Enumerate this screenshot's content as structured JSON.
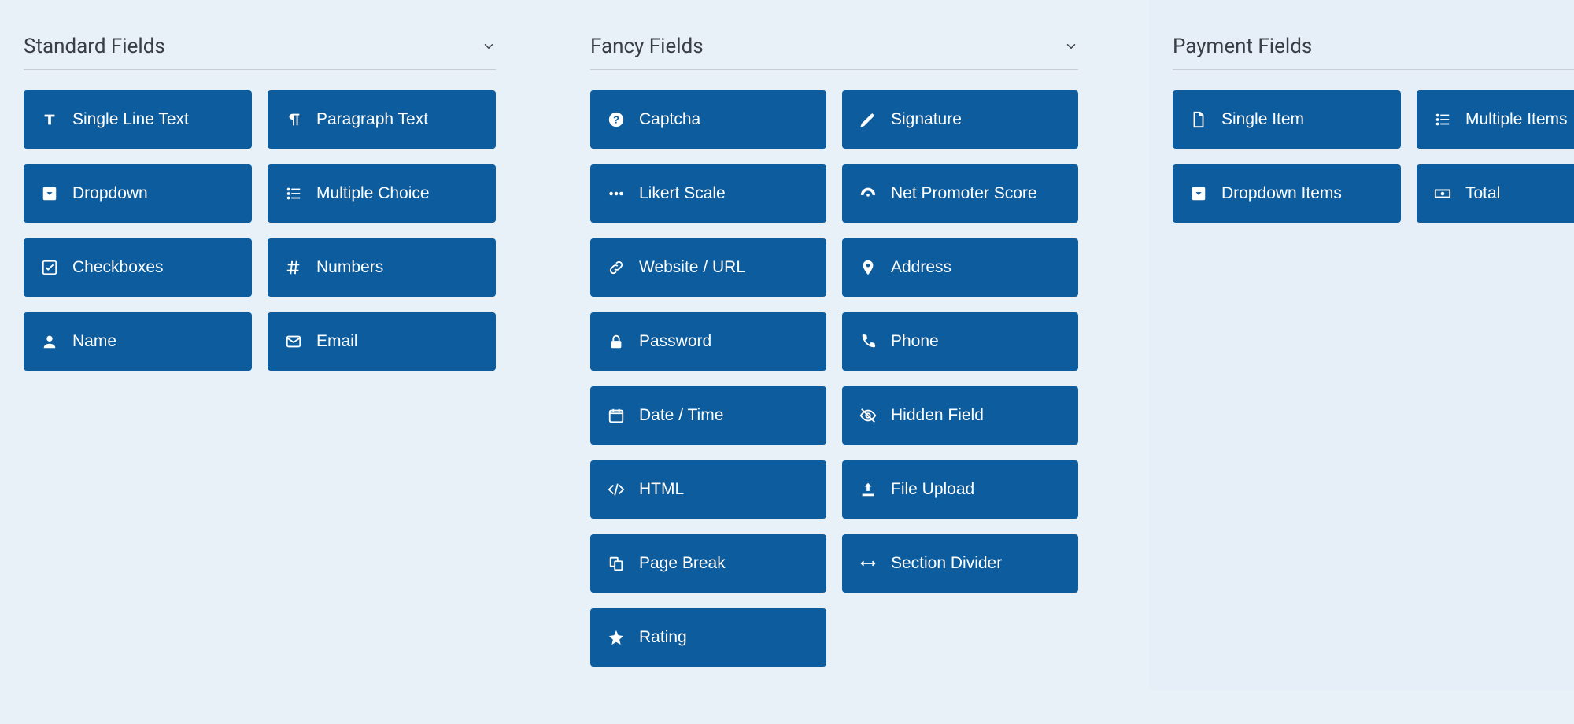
{
  "panels": {
    "standard": {
      "title": "Standard Fields",
      "fields": [
        {
          "label": "Single Line Text",
          "name": "single-line-text",
          "icon": "text-cursor"
        },
        {
          "label": "Paragraph Text",
          "name": "paragraph-text",
          "icon": "paragraph"
        },
        {
          "label": "Dropdown",
          "name": "dropdown",
          "icon": "caret-square"
        },
        {
          "label": "Multiple Choice",
          "name": "multiple-choice",
          "icon": "list"
        },
        {
          "label": "Checkboxes",
          "name": "checkboxes",
          "icon": "check-square"
        },
        {
          "label": "Numbers",
          "name": "numbers",
          "icon": "hashtag"
        },
        {
          "label": "Name",
          "name": "name",
          "icon": "user"
        },
        {
          "label": "Email",
          "name": "email",
          "icon": "envelope"
        }
      ]
    },
    "fancy": {
      "title": "Fancy Fields",
      "fields": [
        {
          "label": "Captcha",
          "name": "captcha",
          "icon": "question-circle"
        },
        {
          "label": "Signature",
          "name": "signature",
          "icon": "pencil"
        },
        {
          "label": "Likert Scale",
          "name": "likert-scale",
          "icon": "ellipsis"
        },
        {
          "label": "Net Promoter Score",
          "name": "net-promoter-score",
          "icon": "gauge"
        },
        {
          "label": "Website / URL",
          "name": "website-url",
          "icon": "link"
        },
        {
          "label": "Address",
          "name": "address",
          "icon": "pin"
        },
        {
          "label": "Password",
          "name": "password",
          "icon": "lock"
        },
        {
          "label": "Phone",
          "name": "phone",
          "icon": "phone"
        },
        {
          "label": "Date / Time",
          "name": "date-time",
          "icon": "calendar"
        },
        {
          "label": "Hidden Field",
          "name": "hidden-field",
          "icon": "eye-slash"
        },
        {
          "label": "HTML",
          "name": "html",
          "icon": "code"
        },
        {
          "label": "File Upload",
          "name": "file-upload",
          "icon": "upload"
        },
        {
          "label": "Page Break",
          "name": "page-break",
          "icon": "pages"
        },
        {
          "label": "Section Divider",
          "name": "section-divider",
          "icon": "arrows-h"
        },
        {
          "label": "Rating",
          "name": "rating",
          "icon": "star"
        }
      ]
    },
    "payment": {
      "title": "Payment Fields",
      "fields": [
        {
          "label": "Single Item",
          "name": "single-item",
          "icon": "file"
        },
        {
          "label": "Multiple Items",
          "name": "multiple-items",
          "icon": "list"
        },
        {
          "label": "Dropdown Items",
          "name": "dropdown-items",
          "icon": "caret-square"
        },
        {
          "label": "Total",
          "name": "total",
          "icon": "money"
        }
      ]
    }
  },
  "colors": {
    "button": "#0d5c9d",
    "bg": "#e8f0f8"
  }
}
